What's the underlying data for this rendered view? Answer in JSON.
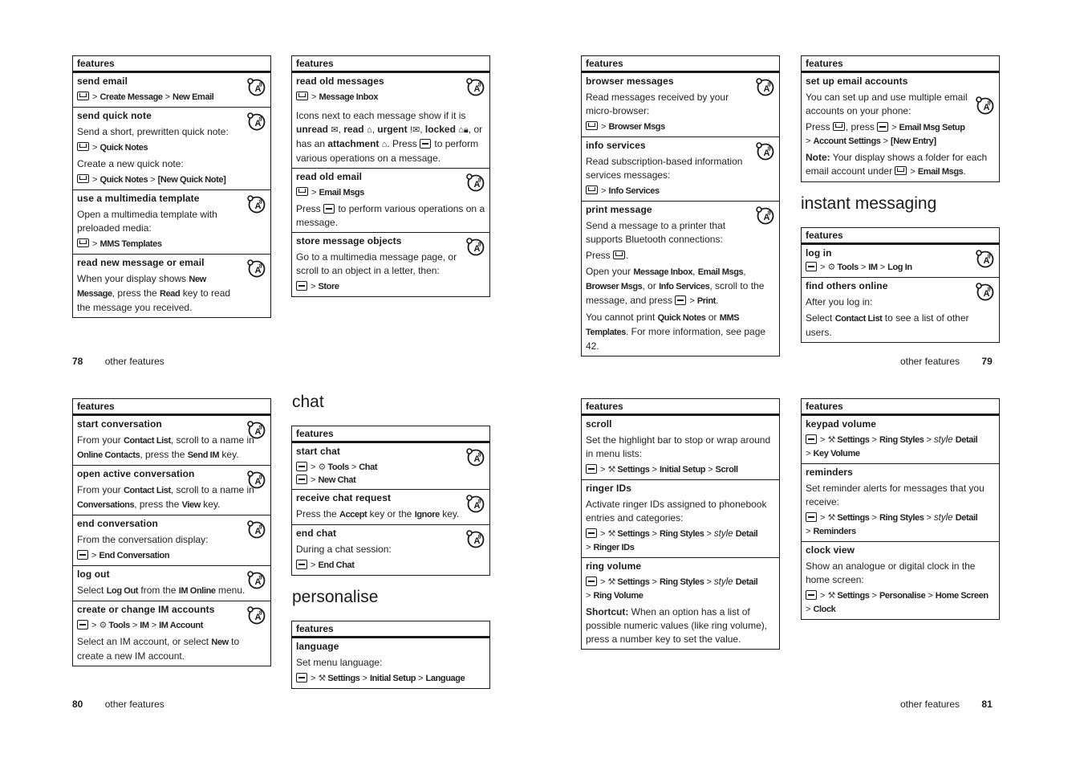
{
  "table_header": "features",
  "pages": {
    "p78": {
      "footer_num": "78",
      "footer_label": "other features",
      "col1": {
        "rows": [
          {
            "title": "send email",
            "path": [
              "Create Message",
              "New Email"
            ]
          },
          {
            "title": "send quick note",
            "desc1": "Send a short, prewritten quick note:",
            "path1": [
              "Quick Notes"
            ],
            "desc2": "Create a new quick note:",
            "path2": [
              "Quick Notes",
              "[New Quick Note]"
            ]
          },
          {
            "title": "use a multimedia template",
            "desc": "Open a multimedia template with preloaded media:",
            "path": [
              "MMS Templates"
            ]
          },
          {
            "title": "read new message or email",
            "desc_a": "When your display shows ",
            "k1": "New Message",
            "desc_b": ", press the ",
            "k2": "Read",
            "desc_c": " key to read the message you received."
          }
        ]
      },
      "col2": {
        "rows": [
          {
            "title": "read old messages",
            "path": [
              "Message Inbox"
            ],
            "d1": "Icons next to each message show if it is ",
            "unread": "unread",
            "read": "read",
            "urgent": "urgent",
            "locked": "locked",
            "d2": "or has an ",
            "attachment": "attachment",
            "d3": ". Press ",
            "d4": " to perform various operations on a message."
          },
          {
            "title": "read old email",
            "path": [
              "Email Msgs"
            ],
            "d1": "Press ",
            "d2": " to perform various operations on a message."
          },
          {
            "title": "store message objects",
            "desc": "Go to a multimedia message page, or scroll to an object in a letter, then:",
            "path": [
              "Store"
            ]
          }
        ]
      }
    },
    "p79": {
      "footer_num": "79",
      "footer_label": "other features",
      "col1": {
        "rows": [
          {
            "title": "browser messages",
            "desc": "Read messages received by your micro-browser:",
            "path": [
              "Browser Msgs"
            ]
          },
          {
            "title": "info services",
            "desc": "Read subscription-based information services messages:",
            "path": [
              "Info Services"
            ]
          },
          {
            "title": "print message",
            "desc": "Send a message to a printer that supports Bluetooth connections:",
            "press": "Press",
            "o1": "Open your ",
            "k1": "Message Inbox",
            "k2": "Email Msgs",
            "k3": "Browser Msgs",
            "o2": ", or ",
            "k4": "Info Services",
            "o3": ", scroll to the message, and press ",
            "k5": "Print",
            "c1": "You cannot print ",
            "k6": "Quick Notes",
            "c2": " or ",
            "k7": "MMS Templates",
            "c3": ". For more information, see page 42."
          }
        ]
      },
      "col2": {
        "rows": [
          {
            "title": "set up email accounts",
            "desc": "You can set up and use multiple email accounts on your phone:",
            "press": "Press",
            "press2": ", press",
            "path": [
              "Email Msg Setup",
              "Account Settings",
              "[New Entry]"
            ],
            "note_label": "Note:",
            "note": " Your display shows a folder for each email account under ",
            "note_path": "Email Msgs"
          }
        ]
      },
      "section_im": "instant messaging",
      "col2b": {
        "rows": [
          {
            "title": "log in",
            "path": [
              "Tools",
              "IM",
              "Log In"
            ]
          },
          {
            "title": "find others online",
            "desc": "After you log in:",
            "s1": "Select ",
            "k1": "Contact List",
            "s2": " to see a list of other users."
          }
        ]
      }
    },
    "p80": {
      "footer_num": "80",
      "footer_label": "other features",
      "col1": {
        "rows": [
          {
            "title": "start conversation",
            "a": "From your ",
            "k1": "Contact List",
            "b": ", scroll to a name in ",
            "k2": "Online Contacts",
            "c": ", press the ",
            "k3": "Send IM",
            "d": " key."
          },
          {
            "title": "open active conversation",
            "a": "From your ",
            "k1": "Contact List",
            "b": ", scroll to a name in ",
            "k2": "Conversations",
            "c": ", press the ",
            "k3": "View",
            "d": " key."
          },
          {
            "title": "end conversation",
            "desc": "From the conversation display:",
            "path": [
              "End Conversation"
            ]
          },
          {
            "title": "log out",
            "a": "Select ",
            "k1": "Log Out",
            "b": " from the ",
            "k2": "IM Online",
            "c": " menu."
          },
          {
            "title": "create or change IM accounts",
            "path": [
              "Tools",
              "IM",
              "IM Account"
            ],
            "a": "Select an IM account, or select ",
            "k1": "New",
            "b": " to create a new IM account."
          }
        ]
      },
      "section_chat": "chat",
      "chat": {
        "rows": [
          {
            "title": "start chat",
            "path1": [
              "Tools",
              "Chat"
            ],
            "path2": [
              "New Chat"
            ]
          },
          {
            "title": "receive chat request",
            "a": "Press the ",
            "k1": "Accept",
            "b": " key or the ",
            "k2": "Ignore",
            "c": " key."
          },
          {
            "title": "end chat",
            "desc": "During a chat session:",
            "path": [
              "End Chat"
            ]
          }
        ]
      },
      "section_personalise": "personalise",
      "personalise": {
        "rows": [
          {
            "title": "language",
            "desc": "Set menu language:",
            "path": [
              "Settings",
              "Initial Setup",
              "Language"
            ]
          }
        ]
      }
    },
    "p81": {
      "footer_num": "81",
      "footer_label": "other features",
      "col1": {
        "rows": [
          {
            "title": "scroll",
            "desc": "Set the highlight bar to stop or wrap around in menu lists:",
            "path": [
              "Settings",
              "Initial Setup",
              "Scroll"
            ]
          },
          {
            "title": "ringer IDs",
            "desc": "Activate ringer IDs assigned to phonebook entries and categories:",
            "p1": "Settings",
            "p2": "Ring Styles",
            "p3i": "style",
            "p3": "Detail",
            "p4": "Ringer IDs"
          },
          {
            "title": "ring volume",
            "p1": "Settings",
            "p2": "Ring Styles",
            "p3i": "style",
            "p3": "Detail",
            "p4": "Ring Volume",
            "sc_label": "Shortcut:",
            "sc": " When an option has a list of possible numeric values (like ring volume), press a number key to set the value."
          }
        ]
      },
      "col2": {
        "rows": [
          {
            "title": "keypad volume",
            "p1": "Settings",
            "p2": "Ring Styles",
            "p3i": "style",
            "p3": "Detail",
            "p4": "Key Volume"
          },
          {
            "title": "reminders",
            "desc": "Set reminder alerts for messages that you receive:",
            "p1": "Settings",
            "p2": "Ring Styles",
            "p3i": "style",
            "p3": "Detail",
            "p4": "Reminders"
          },
          {
            "title": "clock view",
            "desc": "Show an analogue or digital clock in the home screen:",
            "p1": "Settings",
            "p2": "Personalise",
            "p3": "Home Screen",
            "p4": "Clock"
          }
        ]
      }
    }
  },
  "sep": ">",
  "icons": {
    "network": "network-dependent-icon",
    "message_key": "message-key-icon",
    "menu_key": "menu-key-icon",
    "tools": "tools-icon",
    "settings": "settings-icon"
  }
}
